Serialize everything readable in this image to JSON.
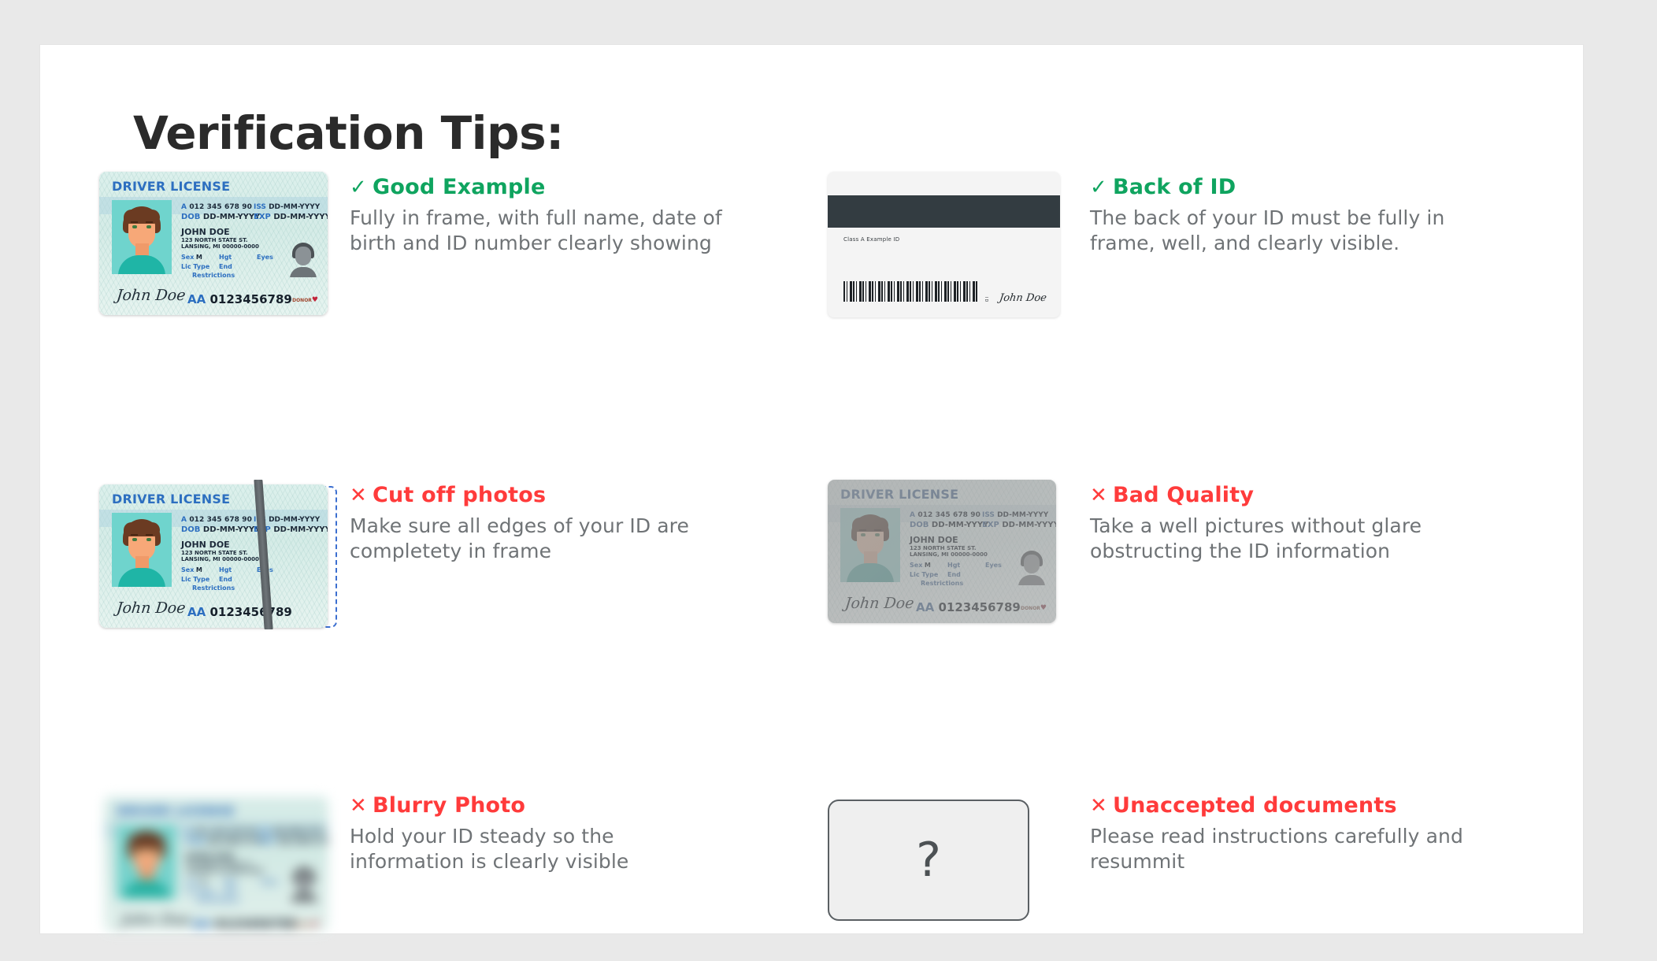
{
  "page": {
    "title": "Verification Tips:"
  },
  "colors": {
    "good": "#0fa45f",
    "bad": "#ff3b3b",
    "body_text": "#6f7376",
    "title": "#2b2b2b",
    "page_bg": "#e9e9e9",
    "panel_bg": "#ffffff"
  },
  "icons": {
    "check": "✓",
    "cross": "✕",
    "question": "?",
    "heart": "♥"
  },
  "license_card": {
    "title": "DRIVER LICENSE",
    "id_label": "A",
    "id_number": "012 345 678 90",
    "dob_label": "DOB",
    "dob_value": "DD-MM-YYYY",
    "iss_label": "ISS",
    "iss_value": "DD-MM-YYYY",
    "exp_label": "EXP",
    "exp_value": "DD-MM-YYYY",
    "name": "JOHN DOE",
    "address_line1": "123 NORTH STATE ST.",
    "address_line2": "LANSING, MI 00000-0000",
    "sex_label": "Sex",
    "sex_value": "M",
    "hgt_label": "Hgt",
    "eyes_label": "Eyes",
    "lic_type_label": "Lic Type",
    "end_label": "End",
    "restrictions_label": "Restrictions",
    "signature": "John Doe",
    "doc_prefix": "AA",
    "doc_number": "0123456789",
    "donor_label": "DONOR"
  },
  "back_card": {
    "class_text": "Class A Example ID",
    "vertical_code": "ID",
    "signature": "John Doe"
  },
  "tips": [
    {
      "id": "good-example",
      "status": "good",
      "mark": "✓",
      "heading": "Good Example",
      "body": "Fully in frame, with full name, date of birth and ID number clearly showing",
      "visual": "license-front"
    },
    {
      "id": "back-of-id",
      "status": "good",
      "mark": "✓",
      "heading": "Back of ID",
      "body": "The back of your ID must be fully in frame, well, and clearly visible.",
      "visual": "license-back"
    },
    {
      "id": "cut-off-photos",
      "status": "bad",
      "mark": "✕",
      "heading": "Cut off photos",
      "body": "Make sure all edges of your ID are completety in frame",
      "visual": "license-cut-off"
    },
    {
      "id": "bad-quality",
      "status": "bad",
      "mark": "✕",
      "heading": "Bad Quality",
      "body": "Take a well pictures without glare obstructing the ID information",
      "visual": "license-glare"
    },
    {
      "id": "blurry-photo",
      "status": "bad",
      "mark": "✕",
      "heading": "Blurry Photo",
      "body": "Hold your ID steady so the information is clearly visible",
      "visual": "license-blurred"
    },
    {
      "id": "unaccepted-documents",
      "status": "bad",
      "mark": "✕",
      "heading": "Unaccepted documents",
      "body": "Please read instructions carefully and resummit",
      "visual": "unknown-document"
    }
  ]
}
